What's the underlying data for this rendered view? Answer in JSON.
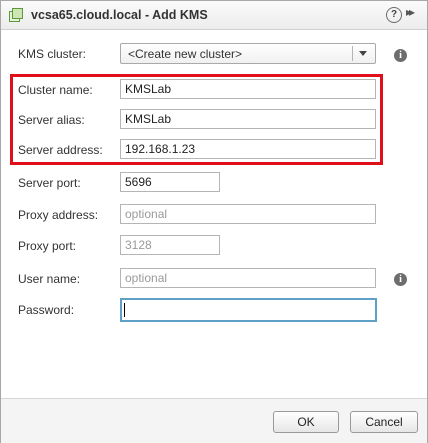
{
  "window": {
    "title": "vcsa65.cloud.local - Add KMS",
    "help_icon": "help-icon",
    "expand_icon": "expand-icon",
    "help_glyph": "?",
    "expand_glyph": "▸▸"
  },
  "form": {
    "kms_cluster": {
      "label": "KMS cluster:",
      "value": "<Create new cluster>"
    },
    "cluster_name": {
      "label": "Cluster name:",
      "value": "KMSLab"
    },
    "server_alias": {
      "label": "Server alias:",
      "value": "KMSLab"
    },
    "server_address": {
      "label": "Server address:",
      "value": "192.168.1.23"
    },
    "server_port": {
      "label": "Server port:",
      "value": "5696"
    },
    "proxy_address": {
      "label": "Proxy address:",
      "placeholder": "optional"
    },
    "proxy_port": {
      "label": "Proxy port:",
      "placeholder": "3128"
    },
    "user_name": {
      "label": "User name:",
      "placeholder": "optional"
    },
    "password": {
      "label": "Password:",
      "value": ""
    }
  },
  "info_glyph": "i",
  "footer": {
    "ok_label": "OK",
    "cancel_label": "Cancel"
  },
  "colors": {
    "highlight": "#e0101a",
    "focus_border": "#5fa0c7",
    "app_icon": "#6ab04c"
  }
}
